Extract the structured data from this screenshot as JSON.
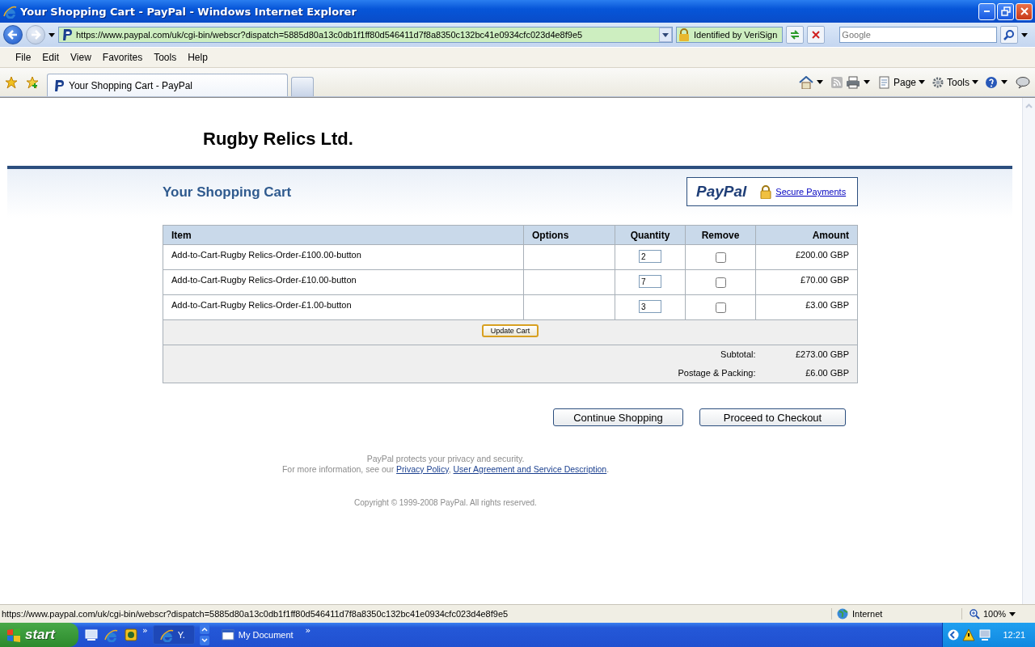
{
  "window": {
    "title": "Your Shopping Cart - PayPal - Windows Internet Explorer"
  },
  "address_bar": {
    "url": "https://www.paypal.com/uk/cgi-bin/webscr?dispatch=5885d80a13c0db1f1ff80d546411d7f8a8350c132bc41e0934cfc023d4e8f9e5",
    "identity": "Identified by VeriSign"
  },
  "search": {
    "placeholder": "Google"
  },
  "menu": [
    "File",
    "Edit",
    "View",
    "Favorites",
    "Tools",
    "Help"
  ],
  "tabs": [
    {
      "label": "Your Shopping Cart - PayPal",
      "selected": true
    }
  ],
  "command_bar": [
    "Page",
    "Tools"
  ],
  "page": {
    "merchant": "Rugby Relics Ltd.",
    "heading": "Your Shopping Cart",
    "paypal_logo": "PayPal",
    "secure_link": "Secure Payments",
    "cart": {
      "columns": [
        "Item",
        "Options",
        "Quantity",
        "Remove",
        "Amount"
      ],
      "rows": [
        {
          "item": "Add-to-Cart-Rugby Relics-Order-£100.00-button",
          "quantity": "2",
          "remove": false,
          "amount": "£200.00 GBP"
        },
        {
          "item": "Add-to-Cart-Rugby Relics-Order-£10.00-button",
          "quantity": "7",
          "remove": false,
          "amount": "£70.00 GBP"
        },
        {
          "item": "Add-to-Cart-Rugby Relics-Order-£1.00-button",
          "quantity": "3",
          "remove": false,
          "amount": "£3.00 GBP"
        }
      ],
      "update_button": "Update Cart",
      "totals": [
        {
          "label": "Subtotal:",
          "value": "£273.00 GBP"
        },
        {
          "label": "Postage & Packing:",
          "value": "£6.00 GBP"
        }
      ]
    },
    "buttons": [
      "Continue Shopping",
      "Proceed to Checkout"
    ],
    "privacy_note": "PayPal protects your privacy and security.",
    "info": [
      {
        "kind": "text",
        "text": "For more information, see our "
      },
      {
        "kind": "link",
        "text": "Privacy Policy"
      },
      {
        "kind": "text",
        "text": ", "
      },
      {
        "kind": "link",
        "text": "User Agreement and Service Description"
      },
      {
        "kind": "text",
        "text": "."
      }
    ],
    "copyright": "Copyright © 1999-2008 PayPal. All rights reserved."
  },
  "status_bar": {
    "url": "https://www.paypal.com/uk/cgi-bin/webscr?dispatch=5885d80a13c0db1f1ff80d546411d7f8a8350c132bc41e0934cfc023d4e8f9e5",
    "zone": "Internet",
    "zoom": "100%"
  },
  "taskbar": {
    "start": "start",
    "quick_launch_more": "»",
    "tasks": [
      {
        "label": "Y.",
        "selected": true
      },
      {
        "label": "My Document",
        "selected": false
      }
    ],
    "tasks_more": "»",
    "clock": "12:21"
  }
}
